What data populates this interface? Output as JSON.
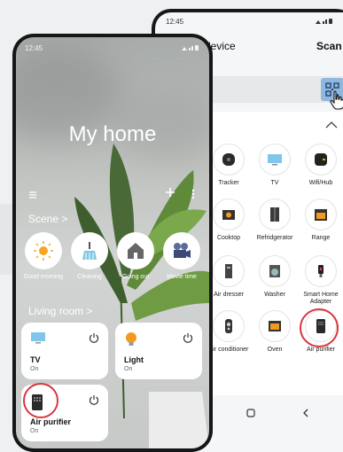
{
  "back_phone": {
    "status": {
      "time": "12:45",
      "icons": "⚫ ▮"
    },
    "title": "Add device",
    "title_visible": "device",
    "scan_label": "Scan",
    "devices": [
      {
        "label": "Tracker",
        "icon": "tracker-icon"
      },
      {
        "label": "TV",
        "icon": "tv-icon"
      },
      {
        "label": "Wifi/Hub",
        "icon": "wifi-hub-icon"
      },
      {
        "label": "Cooktop",
        "icon": "cooktop-icon"
      },
      {
        "label": "Refridgerator",
        "icon": "refrigerator-icon"
      },
      {
        "label": "Range",
        "icon": "range-icon"
      },
      {
        "label": "Air dresser",
        "icon": "air-dresser-icon"
      },
      {
        "label": "Washer",
        "icon": "washer-icon"
      },
      {
        "label": "Smart Home Adapter",
        "icon": "adapter-icon"
      },
      {
        "label": "Air conditioner",
        "icon": "air-conditioner-icon"
      },
      {
        "label": "Oven",
        "icon": "oven-icon"
      },
      {
        "label": "Air purifier",
        "icon": "air-purifier-icon"
      }
    ]
  },
  "front_phone": {
    "status": {
      "time": "12:45",
      "icons": "⚫ ▮"
    },
    "home_title": "My home",
    "scene_header": "Scene  >",
    "scenes": [
      {
        "label": "Good morning",
        "icon": "sun-icon"
      },
      {
        "label": "Cleaning",
        "icon": "broom-icon"
      },
      {
        "label": "Going out",
        "icon": "house-icon"
      },
      {
        "label": "Movie time",
        "icon": "projector-icon"
      }
    ],
    "room_header": "Living room  >",
    "devices": [
      {
        "name": "TV",
        "state": "On",
        "icon": "tv-icon"
      },
      {
        "name": "Light",
        "state": "On",
        "icon": "bulb-icon"
      },
      {
        "name": "Air purifier",
        "state": "On",
        "icon": "air-purifier-icon"
      }
    ]
  },
  "colors": {
    "highlight": "#d9363e",
    "qr_button": "#8fb7df",
    "accent_orange": "#f39a1e"
  }
}
